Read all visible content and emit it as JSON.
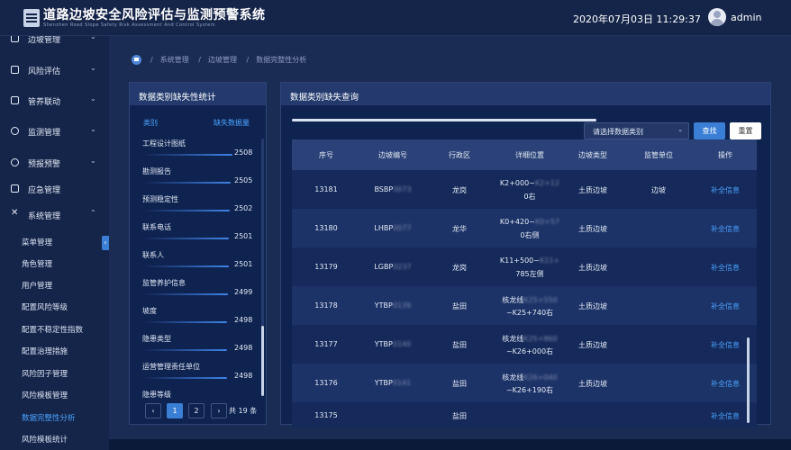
{
  "header": {
    "title": "道路边坡安全风险评估与监测预警系统",
    "subtitle": "Shenzhen Road Slope Safety Risk Assessment And Control System",
    "datetime": "2020年07月03日 11:29:37",
    "user": "admin"
  },
  "sidebar": {
    "items": [
      {
        "label": "边坡管理",
        "icon": "slope-icon"
      },
      {
        "label": "风险评估",
        "icon": "assessment-icon"
      },
      {
        "label": "管养联动",
        "icon": "maintenance-icon"
      },
      {
        "label": "监测管理",
        "icon": "monitor-icon"
      },
      {
        "label": "预报预警",
        "icon": "warning-icon"
      },
      {
        "label": "应急管理",
        "icon": "emergency-icon"
      },
      {
        "label": "系统管理",
        "icon": "tools-icon"
      }
    ],
    "sub_items": [
      "菜单管理",
      "角色管理",
      "用户管理",
      "配置风险等级",
      "配置不稳定性指数",
      "配置治理措施",
      "风险因子管理",
      "风险模板管理",
      "数据完整性分析",
      "风险模板统计"
    ],
    "active_sub": "数据完整性分析"
  },
  "breadcrumb": [
    "系统管理",
    "边坡管理",
    "数据完整性分析"
  ],
  "left_panel": {
    "title": "数据类别缺失性统计",
    "col_category": "类别",
    "col_missing": "缺失数据量",
    "stats": [
      {
        "name": "工程设计图纸",
        "value": "2508"
      },
      {
        "name": "勘测报告",
        "value": "2505"
      },
      {
        "name": "预测稳定性",
        "value": "2502"
      },
      {
        "name": "联系电话",
        "value": "2501"
      },
      {
        "name": "联系人",
        "value": "2501"
      },
      {
        "name": "监管养护信息",
        "value": "2499"
      },
      {
        "name": "坡度",
        "value": "2498"
      },
      {
        "name": "隐患类型",
        "value": "2498"
      },
      {
        "name": "运营管理责任单位",
        "value": "2498"
      },
      {
        "name": "隐患等级",
        "value": ""
      }
    ],
    "pagination": {
      "prev": "‹",
      "pages": [
        "1",
        "2"
      ],
      "next": "›",
      "total": "共 19 条",
      "current": "1"
    }
  },
  "right_panel": {
    "title": "数据类别缺失查询",
    "select_placeholder": "请选择数据类别",
    "search_label": "查找",
    "reset_label": "重置",
    "columns": [
      "序号",
      "边坡编号",
      "行政区",
      "详细位置",
      "边坡类型",
      "监管单位",
      "操作"
    ],
    "rows": [
      {
        "no": "13181",
        "code_a": "BSBP",
        "code_b": "0073",
        "district": "龙岗",
        "loc1a": "K2+000~",
        "loc1b": "K2+12",
        "loc2": "0右",
        "type": "土质边坡",
        "unit": "边坡",
        "action": "补全信息"
      },
      {
        "no": "13180",
        "code_a": "LHBP",
        "code_b": "0077",
        "district": "龙华",
        "loc1a": "K0+420~",
        "loc1b": "K0+57",
        "loc2": "0右侧",
        "type": "土质边坡",
        "unit": "",
        "action": "补全信息"
      },
      {
        "no": "13179",
        "code_a": "LGBP",
        "code_b": "0237",
        "district": "龙岗",
        "loc1a": "K11+500~",
        "loc1b": "K11+",
        "loc2": "785左侧",
        "type": "土质边坡",
        "unit": "",
        "action": "补全信息"
      },
      {
        "no": "13178",
        "code_a": "YTBP",
        "code_b": "0139",
        "district": "盐田",
        "loc1a": "核龙线",
        "loc1b": "K25+550",
        "loc2": "~K25+740右",
        "type": "土质边坡",
        "unit": "",
        "action": "补全信息"
      },
      {
        "no": "13177",
        "code_a": "YTBP",
        "code_b": "0140",
        "district": "盐田",
        "loc1a": "核龙线",
        "loc1b": "K25+860",
        "loc2": "~K26+000右",
        "type": "土质边坡",
        "unit": "",
        "action": "补全信息"
      },
      {
        "no": "13176",
        "code_a": "YTBP",
        "code_b": "0141",
        "district": "盐田",
        "loc1a": "核龙线",
        "loc1b": "K26+040",
        "loc2": "~K26+190右",
        "type": "土质边坡",
        "unit": "",
        "action": "补全信息"
      },
      {
        "no": "13175",
        "code_a": "",
        "code_b": "",
        "district": "盐田",
        "loc1a": "",
        "loc1b": "",
        "loc2": "",
        "type": "",
        "unit": "",
        "action": "补全信息"
      }
    ]
  }
}
